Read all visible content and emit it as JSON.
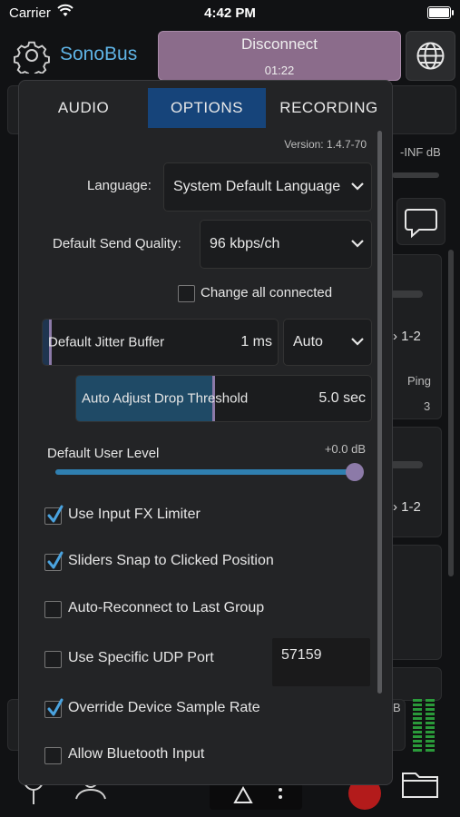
{
  "status_bar": {
    "carrier": "Carrier",
    "time": "4:42 PM"
  },
  "header": {
    "app_title": "SonoBus",
    "disconnect_label": "Disconnect",
    "session_timer": "01:22"
  },
  "background": {
    "level_text": "-INF dB",
    "routing_1": "1-2",
    "routing_2": "1-2",
    "ping_label": "Ping",
    "ping_value": "3",
    "meter_label": "B"
  },
  "popup": {
    "tabs": [
      {
        "label": "AUDIO",
        "active": false
      },
      {
        "label": "OPTIONS",
        "active": true
      },
      {
        "label": "RECORDING",
        "active": false
      }
    ],
    "version": "Version: 1.4.7-70",
    "language": {
      "label": "Language:",
      "value": "System Default Language"
    },
    "send_quality": {
      "label": "Default Send Quality:",
      "value": "96 kbps/ch"
    },
    "change_all_connected": {
      "label": "Change all connected",
      "checked": false
    },
    "jitter_buffer": {
      "label": "Default Jitter Buffer",
      "value": "1 ms",
      "mode": "Auto"
    },
    "drop_threshold": {
      "label": "Auto Adjust Drop Threshold",
      "value": "5.0 sec",
      "level": 0.46
    },
    "user_level": {
      "label": "Default User Level",
      "value": "+0.0 dB",
      "level": 1.0
    },
    "options": [
      {
        "label": "Use Input FX Limiter",
        "checked": true
      },
      {
        "label": "Sliders Snap to Clicked Position",
        "checked": true
      },
      {
        "label": "Auto-Reconnect to Last Group",
        "checked": false
      },
      {
        "label": "Use Specific UDP Port",
        "checked": false
      },
      {
        "label": "Override Device Sample Rate",
        "checked": true
      },
      {
        "label": "Allow Bluetooth Input",
        "checked": false
      }
    ],
    "udp_port": "57159"
  },
  "colors": {
    "accent_blue": "#5fb4e6",
    "active_tab": "#16447a",
    "disconnect": "#8b6c8b",
    "check_blue": "#4aa3df",
    "slider_thumb": "#8c7aa8"
  }
}
